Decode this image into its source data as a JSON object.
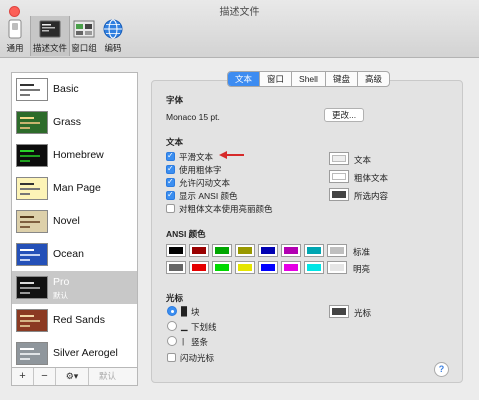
{
  "window": {
    "title": "描述文件"
  },
  "toolbar": {
    "items": [
      {
        "label": "通用",
        "icon": "switch-icon"
      },
      {
        "label": "描述文件",
        "icon": "profile-terminal-icon",
        "selected": true
      },
      {
        "label": "窗口组",
        "icon": "window-group-icon"
      },
      {
        "label": "编码",
        "icon": "globe-icon"
      }
    ]
  },
  "profiles": {
    "items": [
      {
        "name": "Basic",
        "bg": "#ffffff",
        "fg": "#222222"
      },
      {
        "name": "Grass",
        "bg": "#2d6b2a",
        "fg": "#f3d98a"
      },
      {
        "name": "Homebrew",
        "bg": "#0c0c0c",
        "fg": "#28d028"
      },
      {
        "name": "Man Page",
        "bg": "#fdf4b7",
        "fg": "#222222"
      },
      {
        "name": "Novel",
        "bg": "#ddd0aa",
        "fg": "#5a3d1e"
      },
      {
        "name": "Ocean",
        "bg": "#2450b8",
        "fg": "#ffffff"
      },
      {
        "name": "Pro",
        "bg": "#111111",
        "fg": "#dddddd",
        "selected": true,
        "subtitle": "默认"
      },
      {
        "name": "Red Sands",
        "bg": "#8b3a22",
        "fg": "#f2d7a6"
      },
      {
        "name": "Silver Aerogel",
        "bg": "#8f969c",
        "fg": "#ffffff"
      }
    ],
    "bottom_bar": {
      "add": "+",
      "remove": "−",
      "gear": "⚙▾",
      "default_label": "默认"
    }
  },
  "tabs": [
    {
      "label": "文本",
      "selected": true
    },
    {
      "label": "窗口"
    },
    {
      "label": "Shell"
    },
    {
      "label": "键盘"
    },
    {
      "label": "高级"
    }
  ],
  "text_tab": {
    "font": {
      "heading": "字体",
      "value": "Monaco 15 pt.",
      "change_button": "更改..."
    },
    "text": {
      "heading": "文本",
      "options": [
        {
          "label": "平滑文本",
          "checked": true
        },
        {
          "label": "使用粗体字",
          "checked": true
        },
        {
          "label": "允许闪动文本",
          "checked": true
        },
        {
          "label": "显示 ANSI 颜色",
          "checked": true
        },
        {
          "label": "对粗体文本使用亮丽颜色",
          "checked": false
        }
      ],
      "colors": [
        {
          "label": "文本",
          "color": "#eeeeee"
        },
        {
          "label": "粗体文本",
          "color": "#ffffff"
        },
        {
          "label": "所选内容",
          "color": "#444444"
        }
      ]
    },
    "ansi": {
      "heading": "ANSI 颜色",
      "normal_label": "标准",
      "bright_label": "明亮",
      "normal": [
        "#000000",
        "#990000",
        "#00a600",
        "#999900",
        "#0000b2",
        "#b200b2",
        "#00a6b2",
        "#bfbfbf"
      ],
      "bright": [
        "#666666",
        "#e50000",
        "#00d900",
        "#e5e500",
        "#0000ff",
        "#e500e5",
        "#00e5e5",
        "#e5e5e5"
      ]
    },
    "cursor": {
      "heading": "光标",
      "options": [
        {
          "glyph": "█",
          "label": "块",
          "selected": true
        },
        {
          "glyph": "▁",
          "label": "下划线",
          "selected": false
        },
        {
          "glyph": "|",
          "label": "竖条",
          "selected": false
        }
      ],
      "blink_label": "闪动光标",
      "blink_checked": false,
      "color_label": "光标",
      "color": "#444444"
    },
    "help": "?"
  },
  "annotation": {
    "color": "#d62a2a"
  }
}
